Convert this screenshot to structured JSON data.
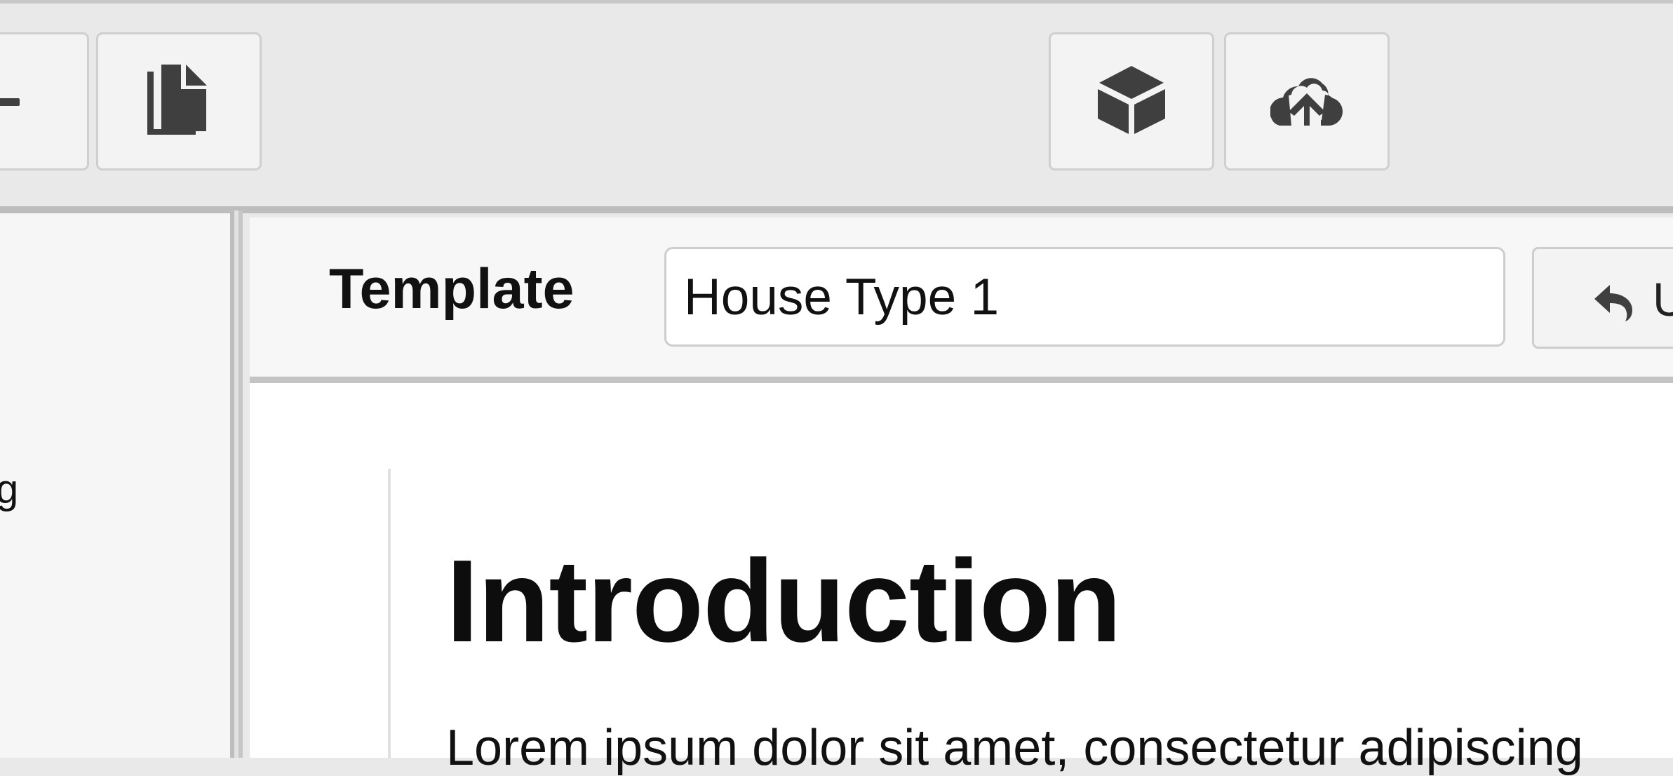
{
  "toolbar": {
    "buttons": [
      {
        "icon": "remove-icon"
      },
      {
        "icon": "copy-icon"
      },
      {
        "icon": "cube-icon"
      },
      {
        "icon": "cloud-upload-icon"
      }
    ]
  },
  "sidebar": {
    "partial_text": "g"
  },
  "editor": {
    "template_label": "Template",
    "template_value": "House Type 1",
    "undo_label": "Undo",
    "undo_icon": "undo-icon"
  },
  "document": {
    "heading": "Introduction",
    "paragraph": "Lorem ipsum dolor sit amet, consectetur adipiscing"
  }
}
